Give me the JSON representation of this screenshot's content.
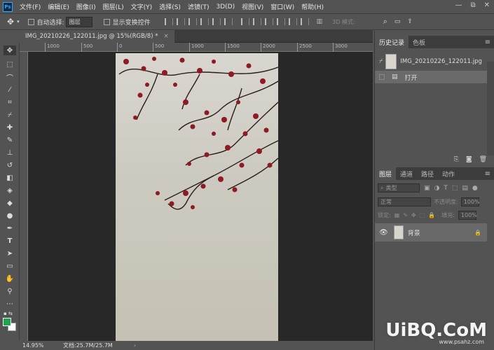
{
  "app": {
    "logo": "Ps",
    "menu": [
      "文件(F)",
      "编辑(E)",
      "图像(I)",
      "图层(L)",
      "文字(Y)",
      "选择(S)",
      "滤镜(T)",
      "3D(D)",
      "视图(V)",
      "窗口(W)",
      "帮助(H)"
    ],
    "window_controls": [
      "—",
      "⧉",
      "✕"
    ]
  },
  "options_bar": {
    "auto_select_label": "自动选择:",
    "auto_select_value": "图层",
    "show_transform_label": "显示变换控件",
    "mode_3d_label": "3D 模式:"
  },
  "document": {
    "tab_title": "IMG_20210226_122011.jpg @ 15%(RGB/8) *",
    "close": "×",
    "ruler_ticks": [
      "1000",
      "500",
      "0",
      "500",
      "1000",
      "1500",
      "2000",
      "2500",
      "3000"
    ],
    "zoom": "14.95%",
    "doc_info": "文档:25.7M/25.7M"
  },
  "history_panel": {
    "tabs": [
      "历史记录",
      "色板"
    ],
    "snapshot_name": "IMG_20210226_122011.jpg",
    "steps": [
      "打开"
    ]
  },
  "layers_panel": {
    "tabs": [
      "图层",
      "通道",
      "路径",
      "动作"
    ],
    "filter_placeholder": "类型",
    "blend_mode": "正常",
    "opacity_label": "不透明度:",
    "opacity_value": "100%",
    "lock_label": "锁定:",
    "fill_label": "填充:",
    "fill_value": "100%",
    "layers": [
      {
        "name": "背景",
        "locked": true,
        "visible": true
      }
    ]
  },
  "watermark": {
    "main": "UiBQ.CoM",
    "sub": "www.psahz.com"
  },
  "colors": {
    "foreground": "#1aa64a",
    "background": "#ffffff",
    "accent": "#31a8ff"
  }
}
